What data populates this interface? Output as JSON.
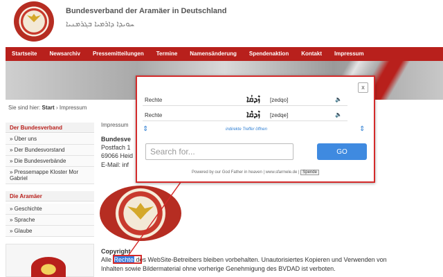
{
  "header": {
    "title": "Bundesverband der Aramäer in Deutschland",
    "subtitle_syriac": "ܚܘܝܕܐ ܕܐܪܡܝܐ ܒܓܪܡܢܝܐ"
  },
  "nav": {
    "items": [
      "Startseite",
      "Newsarchiv",
      "Pressemitteilungen",
      "Termine",
      "Namensänderung",
      "Spendenaktion",
      "Kontakt",
      "Impressum"
    ]
  },
  "breadcrumb": {
    "prefix": "Sie sind hier:",
    "items": [
      "Start",
      "Impressum"
    ]
  },
  "sidebar": {
    "section1": {
      "title": "Der Bundesverband",
      "items": [
        "Über uns",
        "Der Bundesvorstand",
        "Die Bundesverbände",
        "Pressemappe Kloster Mor Gabriel"
      ]
    },
    "section2": {
      "title": "Die Aramäer",
      "items": [
        "Geschichte",
        "Sprache",
        "Glaube"
      ]
    }
  },
  "content": {
    "section_label": "Impressum",
    "org_name": "Bundesve",
    "address1": "Postfach 1",
    "address2": "69066 Heid",
    "email_prefix": "E-Mail: inf",
    "copyright_title": "Copyright",
    "copyright_pre": "Alle ",
    "copyright_word": "Rechte",
    "copyright_post": " des WebSite-Betreibers bleiben vorbehalten. Unautorisiertes Kopieren und Verwenden von",
    "copyright_line2": "Inhalten sowie Bildermaterial ohne vorherige Genehmigung des BVDAD ist verboten."
  },
  "popup": {
    "close_label": "x",
    "results": [
      {
        "de": "Rechte",
        "aramaic": "ܙܶܕܩܳܐ",
        "translit": "[zedqo]"
      },
      {
        "de": "Rechte",
        "aramaic": "ܙܶܕܩܶܐ",
        "translit": "[zedqe]"
      }
    ],
    "arrow_left": "⇕",
    "arrow_right": "⇕",
    "indirect_label": "indirekte Treffer öffnen",
    "search_placeholder": "Search for...",
    "search_value": "",
    "go_label": "GO",
    "footer_text": "Powered by our God Father in heaven | www.sfarmele.de |",
    "spende_label": "Spende"
  },
  "colors": {
    "brand_red": "#b8201c",
    "highlight_red": "#d42a2a",
    "go_blue": "#3f8ae0"
  }
}
